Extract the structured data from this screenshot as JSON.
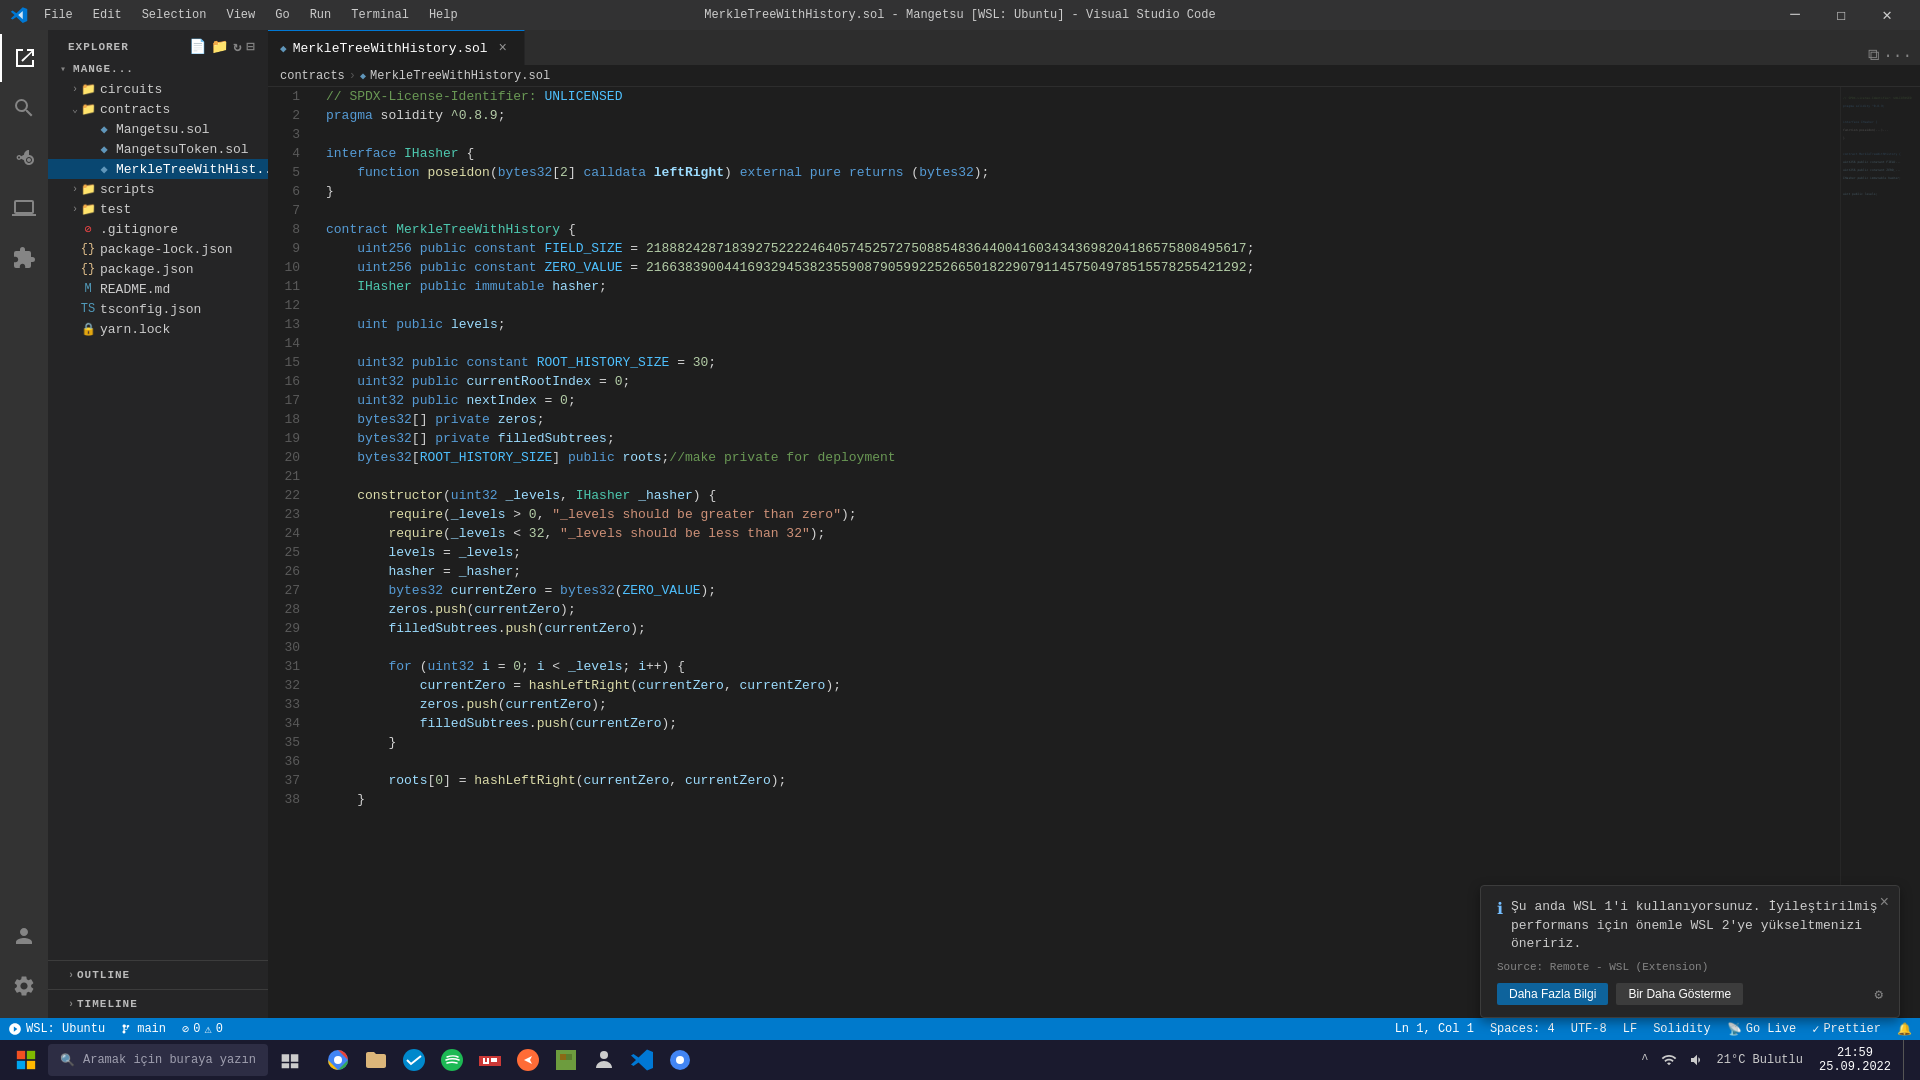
{
  "titleBar": {
    "title": "MerkleTreeWithHistory.sol - Mangetsu [WSL: Ubuntu] - Visual Studio Code",
    "menus": [
      "File",
      "Edit",
      "Selection",
      "View",
      "Go",
      "Run",
      "Terminal",
      "Help"
    ],
    "controls": [
      "minimize",
      "maximize",
      "close"
    ]
  },
  "activityBar": {
    "items": [
      {
        "name": "explorer",
        "icon": "📁"
      },
      {
        "name": "search",
        "icon": "🔍"
      },
      {
        "name": "source-control",
        "icon": "⎇"
      },
      {
        "name": "run-debug",
        "icon": "▷"
      },
      {
        "name": "extensions",
        "icon": "⊞"
      },
      {
        "name": "remote-explorer",
        "icon": "🖥"
      }
    ],
    "bottomItems": [
      {
        "name": "accounts",
        "icon": "👤"
      },
      {
        "name": "settings",
        "icon": "⚙"
      }
    ]
  },
  "sidebar": {
    "title": "EXPLORER",
    "projectName": "MANGE...",
    "fileTree": [
      {
        "type": "folder",
        "name": "circuits",
        "depth": 1,
        "collapsed": true
      },
      {
        "type": "folder",
        "name": "contracts",
        "depth": 1,
        "collapsed": false
      },
      {
        "type": "file",
        "name": "Mangetsu.sol",
        "depth": 2,
        "ext": "sol"
      },
      {
        "type": "file",
        "name": "MangetsuToken.sol",
        "depth": 2,
        "ext": "sol"
      },
      {
        "type": "file",
        "name": "MerkleTreeWithHist...",
        "depth": 2,
        "ext": "sol",
        "selected": true
      },
      {
        "type": "folder",
        "name": "scripts",
        "depth": 1,
        "collapsed": true
      },
      {
        "type": "folder",
        "name": "test",
        "depth": 1,
        "collapsed": true
      },
      {
        "type": "file",
        "name": ".gitignore",
        "depth": 1,
        "ext": "git"
      },
      {
        "type": "file",
        "name": "package-lock.json",
        "depth": 1,
        "ext": "json"
      },
      {
        "type": "file",
        "name": "package.json",
        "depth": 1,
        "ext": "json"
      },
      {
        "type": "file",
        "name": "README.md",
        "depth": 1,
        "ext": "md"
      },
      {
        "type": "file",
        "name": "tsconfig.json",
        "depth": 1,
        "ext": "json"
      },
      {
        "type": "file",
        "name": "yarn.lock",
        "depth": 1,
        "ext": "git"
      }
    ],
    "outline": "OUTLINE",
    "timeline": "TIMELINE"
  },
  "tabs": [
    {
      "label": "MerkleTreeWithHistory.sol",
      "active": true,
      "modified": true
    }
  ],
  "breadcrumb": {
    "parts": [
      "contracts",
      "MerkleTreeWithHistory.sol"
    ]
  },
  "editor": {
    "lines": [
      {
        "num": 1,
        "code": "// SPDX-License-Identifier: UNLICENSED"
      },
      {
        "num": 2,
        "code": "pragma solidity ^0.8.9;"
      },
      {
        "num": 3,
        "code": ""
      },
      {
        "num": 4,
        "code": "interface IHasher {"
      },
      {
        "num": 5,
        "code": "    function poseidon(bytes32[2] calldata leftRight) external pure returns (bytes32);"
      },
      {
        "num": 6,
        "code": "}"
      },
      {
        "num": 7,
        "code": ""
      },
      {
        "num": 8,
        "code": "contract MerkleTreeWithHistory {"
      },
      {
        "num": 9,
        "code": "    uint256 public constant FIELD_SIZE = 21888242871839275222246405745257275088548364400416034343698204186575808495617;"
      },
      {
        "num": 10,
        "code": "    uint256 public constant ZERO_VALUE = 21663839004416932945382355908790599225266501822907911457504978515578255421292;"
      },
      {
        "num": 11,
        "code": "    IHasher public immutable hasher;"
      },
      {
        "num": 12,
        "code": ""
      },
      {
        "num": 13,
        "code": "    uint public levels;"
      },
      {
        "num": 14,
        "code": ""
      },
      {
        "num": 15,
        "code": "    uint32 public constant ROOT_HISTORY_SIZE = 30;"
      },
      {
        "num": 16,
        "code": "    uint32 public currentRootIndex = 0;"
      },
      {
        "num": 17,
        "code": "    uint32 public nextIndex = 0;"
      },
      {
        "num": 18,
        "code": "    bytes32[] private zeros;"
      },
      {
        "num": 19,
        "code": "    bytes32[] private filledSubtrees;"
      },
      {
        "num": 20,
        "code": "    bytes32[ROOT_HISTORY_SIZE] public roots;//make private for deployment"
      },
      {
        "num": 21,
        "code": ""
      },
      {
        "num": 22,
        "code": "    constructor(uint32 _levels, IHasher _hasher) {"
      },
      {
        "num": 23,
        "code": "        require(_levels > 0, \"_levels should be greater than zero\");"
      },
      {
        "num": 24,
        "code": "        require(_levels < 32, \"_levels should be less than 32\");"
      },
      {
        "num": 25,
        "code": "        levels = _levels;"
      },
      {
        "num": 26,
        "code": "        hasher = _hasher;"
      },
      {
        "num": 27,
        "code": "        bytes32 currentZero = bytes32(ZERO_VALUE);"
      },
      {
        "num": 28,
        "code": "        zeros.push(currentZero);"
      },
      {
        "num": 29,
        "code": "        filledSubtrees.push(currentZero);"
      },
      {
        "num": 30,
        "code": ""
      },
      {
        "num": 31,
        "code": "        for (uint32 i = 0; i < _levels; i++) {"
      },
      {
        "num": 32,
        "code": "            currentZero = hashLeftRight(currentZero, currentZero);"
      },
      {
        "num": 33,
        "code": "            zeros.push(currentZero);"
      },
      {
        "num": 34,
        "code": "            filledSubtrees.push(currentZero);"
      },
      {
        "num": 35,
        "code": "        }"
      },
      {
        "num": 36,
        "code": ""
      },
      {
        "num": 37,
        "code": "        roots[0] = hashLeftRight(currentZero, currentZero);"
      },
      {
        "num": 38,
        "code": "    }"
      }
    ]
  },
  "statusBar": {
    "remote": "WSL: Ubuntu",
    "branch": "main",
    "errors": "0",
    "warnings": "0",
    "position": "Ln 1, Col 1",
    "spaces": "Spaces: 4",
    "encoding": "UTF-8",
    "lineEnding": "LF",
    "language": "Solidity",
    "goLive": "Go Live",
    "prettier": "Prettier"
  },
  "notification": {
    "icon": "ℹ",
    "text": "Şu anda WSL 1'i kullanıyorsunuz. İyileştirilmiş performans için önemle WSL 2'ye yükseltmenizi öneririz.",
    "source": "Source: Remote - WSL (Extension)",
    "btn1": "Daha Fazla Bilgi",
    "btn2": "Bir Daha Gösterme"
  },
  "taskbar": {
    "searchPlaceholder": "Aramak için buraya yazın",
    "sysInfo": "21°C Bulutlu",
    "time": "21:59",
    "date": "25.09.2022"
  }
}
